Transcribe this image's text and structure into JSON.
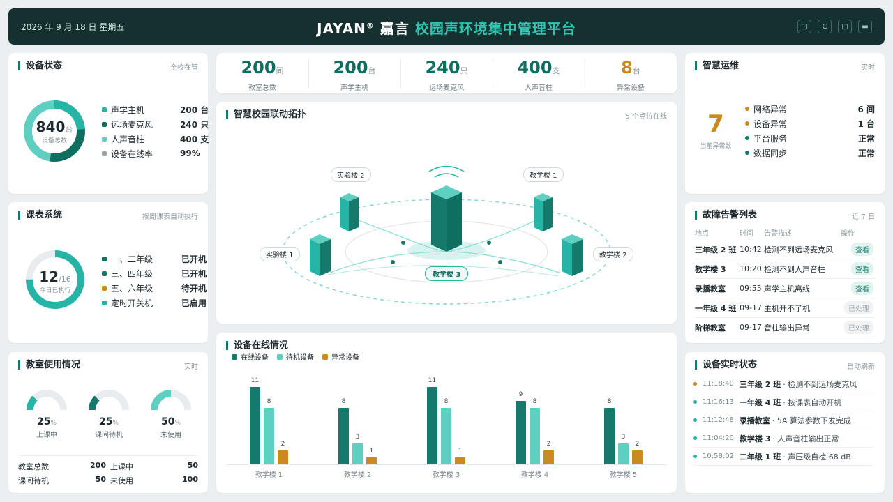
{
  "header": {
    "date": "2026 年 9 月 18 日 星期五",
    "brand": "JAYAN",
    "reg": "®",
    "brand_cn": "嘉言",
    "subtitle": "校园声环境集中管理平台",
    "tools": [
      "square-icon",
      "refresh-icon",
      "window-icon",
      "display-icon"
    ]
  },
  "device_status": {
    "title": "设备状态",
    "meta": "全校在管",
    "total": "840",
    "unit": "台",
    "total_label": "设备总数",
    "items": [
      {
        "label": "声学主机",
        "value": "200 台",
        "color": "#25b4a5"
      },
      {
        "label": "远场麦克风",
        "value": "240 只",
        "color": "#0e6e60"
      },
      {
        "label": "人声音柱",
        "value": "400 支",
        "color": "#5fcfc1"
      },
      {
        "label": "设备在线率",
        "value": "99%",
        "color": "#9aa5ab"
      }
    ]
  },
  "schedule": {
    "title": "课表系统",
    "meta": "按周课表自动执行",
    "done": "12",
    "total": "/16",
    "done_label": "今日已执行",
    "progress": 0.75,
    "items": [
      {
        "label": "一、二年级",
        "value": "已开机",
        "color": "#0e6e60"
      },
      {
        "label": "三、四年级",
        "value": "已开机",
        "color": "#137a6c"
      },
      {
        "label": "五、六年级",
        "value": "待开机",
        "color": "#c98a22"
      },
      {
        "label": "定时开关机",
        "value": "已启用",
        "color": "#25b4a5"
      }
    ]
  },
  "classroom": {
    "title": "教室使用情况",
    "meta": "实时",
    "gauges": [
      {
        "value": "25",
        "pct": "%",
        "label": "上课中",
        "frac": 0.25,
        "color": "#25b4a5"
      },
      {
        "value": "25",
        "pct": "%",
        "label": "课间待机",
        "frac": 0.25,
        "color": "#137a6c"
      },
      {
        "value": "50",
        "pct": "%",
        "label": "未使用",
        "frac": 0.5,
        "color": "#5fcfc1"
      }
    ],
    "stats": [
      {
        "k": "教室总数",
        "v": "200"
      },
      {
        "k": "上课中",
        "v": "50"
      },
      {
        "k": "课间待机",
        "v": "50"
      },
      {
        "k": "未使用",
        "v": "100"
      }
    ]
  },
  "kpis": [
    {
      "n": "200",
      "u": "间",
      "l": "教室总数",
      "color": "#0e6e60"
    },
    {
      "n": "200",
      "u": "台",
      "l": "声学主机",
      "color": "#0e6e60"
    },
    {
      "n": "240",
      "u": "只",
      "l": "远场麦克风",
      "color": "#0e6e60"
    },
    {
      "n": "400",
      "u": "支",
      "l": "人声音柱",
      "color": "#0e6e60"
    },
    {
      "n": "8",
      "u": "台",
      "l": "异常设备",
      "color": "#c98a22"
    }
  ],
  "topology": {
    "title": "智慧校园联动拓扑",
    "meta": "5 个点位在线",
    "center": "教学楼 3",
    "nodes": [
      "实验楼 2",
      "教学楼 1",
      "实验楼 1",
      "教学楼 2"
    ]
  },
  "chart": {
    "title": "设备在线情况",
    "legend": [
      "在线设备",
      "待机设备",
      "异常设备"
    ]
  },
  "chart_data": {
    "type": "bar",
    "categories": [
      "教学楼 1",
      "教学楼 2",
      "教学楼 3",
      "教学楼 4",
      "教学楼 5"
    ],
    "series": [
      {
        "name": "在线设备",
        "values": [
          11,
          8,
          11,
          9,
          8
        ],
        "color": "#137a6c"
      },
      {
        "name": "待机设备",
        "values": [
          8,
          3,
          8,
          8,
          3
        ],
        "color": "#5fcfc1"
      },
      {
        "name": "异常设备",
        "values": [
          2,
          1,
          1,
          2,
          2
        ],
        "color": "#c98a22"
      }
    ],
    "title": "设备在线情况",
    "xlabel": "",
    "ylabel": "",
    "ylim": [
      0,
      11
    ],
    "grid": false,
    "legend": "top-left"
  },
  "ops": {
    "title": "智慧运维",
    "meta": "实时",
    "count": "7",
    "count_label": "当前异常数",
    "items": [
      {
        "label": "网络异常",
        "value": "6 间",
        "color": "#c98a22"
      },
      {
        "label": "设备异常",
        "value": "1 台",
        "color": "#c98a22"
      },
      {
        "label": "平台服务",
        "value": "正常",
        "color": "#137a6c"
      },
      {
        "label": "数据同步",
        "value": "正常",
        "color": "#137a6c"
      }
    ]
  },
  "alarms": {
    "title": "故障告警列表",
    "meta": "近 7 日",
    "cols": [
      "地点",
      "时间",
      "告警描述",
      "操作"
    ],
    "rows": [
      {
        "loc": "三年级 2 班",
        "time": "10:42",
        "desc": "检测不到远场麦克风",
        "op": "查看",
        "st": "a"
      },
      {
        "loc": "教学楼 3",
        "time": "10:20",
        "desc": "检测不到人声音柱",
        "op": "查看",
        "st": "a"
      },
      {
        "loc": "录播教室",
        "time": "09:55",
        "desc": "声学主机离线",
        "op": "查看",
        "st": "a"
      },
      {
        "loc": "一年级 4 班",
        "time": "09-17",
        "desc": "主机开不了机",
        "op": "已处理",
        "st": "d"
      },
      {
        "loc": "阶梯教室",
        "time": "09-17",
        "desc": "音柱输出异常",
        "op": "已处理",
        "st": "d"
      }
    ]
  },
  "events": {
    "title": "设备实时状态",
    "meta": "自动刷新",
    "rows": [
      {
        "t": "11:18:40",
        "who": "三年级 2 班",
        "what": "· 检测不到远场麦克风",
        "color": "#c98a22"
      },
      {
        "t": "11:16:13",
        "who": "一年级 4 班",
        "what": "· 按课表自动开机",
        "color": "#25b4a5"
      },
      {
        "t": "11:12:48",
        "who": "录播教室",
        "what": "· 5A 算法参数下发完成",
        "color": "#25b4a5"
      },
      {
        "t": "11:04:20",
        "who": "教学楼 3",
        "what": "· 人声音柱输出正常",
        "color": "#25b4a5"
      },
      {
        "t": "10:58:02",
        "who": "二年级 1 班",
        "what": "· 声压级自检 68 dB",
        "color": "#25b4a5"
      }
    ]
  }
}
